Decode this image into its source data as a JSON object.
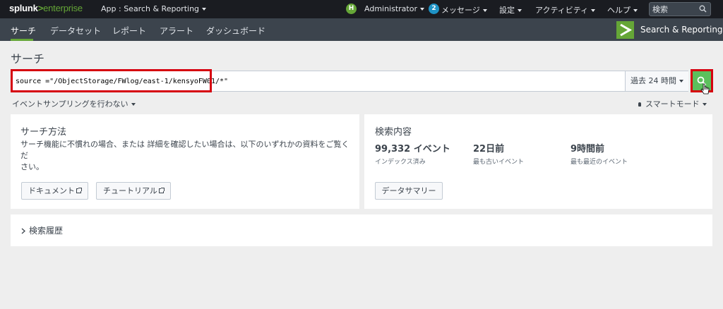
{
  "topbar": {
    "logo_prefix": "splunk",
    "logo_gt": ">",
    "logo_suffix": "enterprise",
    "app_label": "App : Search & Reporting",
    "user_badge": "H",
    "user_label": "Administrator",
    "messages_count": "2",
    "messages_label": "メッセージ",
    "settings_label": "設定",
    "activity_label": "アクティビティ",
    "help_label": "ヘルプ",
    "search_placeholder": "検索"
  },
  "appbar": {
    "tabs": [
      {
        "label": "サーチ",
        "active": true
      },
      {
        "label": "データセット",
        "active": false
      },
      {
        "label": "レポート",
        "active": false
      },
      {
        "label": "アラート",
        "active": false
      },
      {
        "label": "ダッシュボード",
        "active": false
      }
    ],
    "app_title": "Search & Reporting"
  },
  "page": {
    "title": "サーチ",
    "search_query": "source =\"/ObjectStorage/FWlog/east-1/kensyoFW01/*\"",
    "time_range": "過去 24 時間",
    "sampling": "イベントサンプリングを行わない",
    "mode": "スマートモード"
  },
  "how_to": {
    "title": "サーチ方法",
    "text_line1": "サーチ機能に不慣れの場合、または 詳細を確認したい場合は、以下のいずれかの資料をご覧くだ",
    "text_line2": "さい。",
    "doc_button": "ドキュメント",
    "tutorial_button": "チュートリアル"
  },
  "what_to": {
    "title": "検索内容",
    "stats": [
      {
        "value": "99,332 イベント",
        "label": "インデックス済み"
      },
      {
        "value": "22日前",
        "label": "最も古いイベント"
      },
      {
        "value": "9時間前",
        "label": "最も最近のイベント"
      }
    ],
    "summary_button": "データサマリー"
  },
  "history": {
    "title": "検索履歴"
  },
  "colors": {
    "accent_green": "#65a637",
    "highlight_red": "#d6000f",
    "notification_blue": "#1e93c6"
  }
}
